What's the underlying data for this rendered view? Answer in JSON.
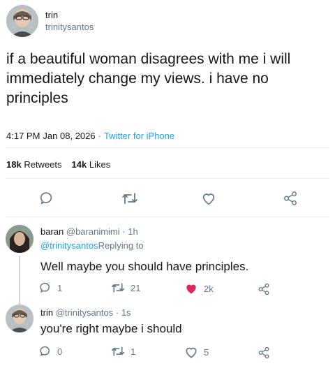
{
  "main_tweet": {
    "display_name": "trin",
    "handle": "trinitysantos",
    "text_line1": "if a beautiful woman disagrees with me i will",
    "text_line2": "immediately change my views. i have no",
    "text_line3": "principles",
    "time": "4:17 PM",
    "date": "Jan 08, 2026",
    "separator": "·",
    "source": "Twitter for iPhone",
    "retweets_count": "18k",
    "retweets_label": "Retweets",
    "likes_count": "14k",
    "likes_label": "Likes"
  },
  "replies": [
    {
      "display_name": "baran",
      "handle": "@baranimimi",
      "time": "· 1h",
      "replying_handle": "@trinitysantos",
      "replying_label": "Replying to",
      "text": "Well maybe you should have principles.",
      "reply_count": "1",
      "retweet_count": "21",
      "like_count": "2k",
      "liked": true
    },
    {
      "display_name": "trin",
      "handle": "@trinitysantos",
      "time": "· 1s",
      "text": "you're right maybe i should",
      "reply_count": "0",
      "retweet_count": "1",
      "like_count": "5",
      "liked": false
    }
  ],
  "colors": {
    "accent": "#1da1f2",
    "muted": "#657786",
    "like_active": "#e0245e",
    "divider": "#e6ecf0"
  },
  "icons": [
    "reply-icon",
    "retweet-icon",
    "like-icon",
    "share-icon"
  ]
}
